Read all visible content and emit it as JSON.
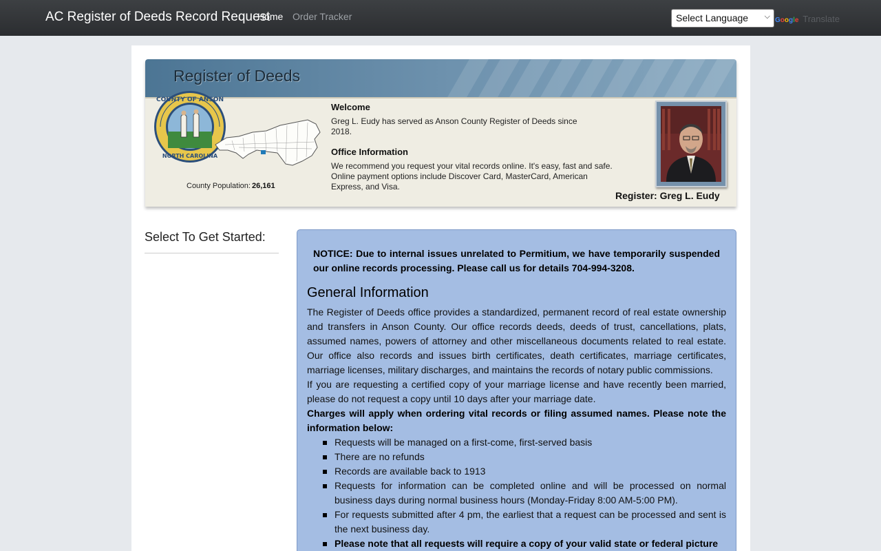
{
  "navbar": {
    "brand": "AC Register of Deeds Record Request",
    "links": [
      "Home",
      "Order Tracker"
    ],
    "language_select": "Select Language",
    "translate_brand": "Google",
    "translate_text": "Translate"
  },
  "banner": {
    "title": "Register of Deeds",
    "seal_text": "COUNTY OF ANSON · NORTH CAROLINA",
    "population_label": "County Population:",
    "population_value": "26,161",
    "welcome_heading": "Welcome",
    "welcome_text": "Greg L. Eudy has served as Anson County Register of Deeds since 2018.",
    "office_heading": "Office Information",
    "office_text": "We recommend you request your vital records online.  It's easy, fast and safe.  Online payment options include Discover Card, MasterCard, American Express, and Visa.",
    "register_label": "Register:  Greg L. Eudy"
  },
  "sidebar": {
    "heading": "Select To Get Started:"
  },
  "panel": {
    "notice": "NOTICE: Due to internal issues unrelated to Permitium, we have temporarily suspended our online records processing. Please call us for details 704-994-3208.",
    "heading": "General Information",
    "paragraph1": "The Register of Deeds office provides a standardized, permanent record of real estate ownership and transfers in Anson County. Our office records deeds, deeds of trust, cancellations, plats, assumed names, powers of attorney and other miscellaneous documents related to real estate. Our office also records and issues birth certificates, death certificates, marriage certificates, marriage licenses, military discharges, and maintains the records of notary public commissions.",
    "paragraph2": "If you are requesting a certified copy of your marriage license and have recently been married, please do not request a copy until 10 days after your marriage date.",
    "charges": "Charges will apply when ordering vital records or filing assumed names. Please note the information below:",
    "bullets": [
      "Requests will be managed on a first-come, first-served basis",
      "There are no refunds",
      "Records are available back to 1913",
      "Requests for information can be completed online and will be processed on normal business days during normal business hours (Monday-Friday 8:00 AM-5:00 PM).",
      "For requests submitted after 4 pm, the earliest that a request can be processed and sent is the next business day.",
      "Please note that all requests will require a copy of your valid state or federal picture"
    ]
  }
}
